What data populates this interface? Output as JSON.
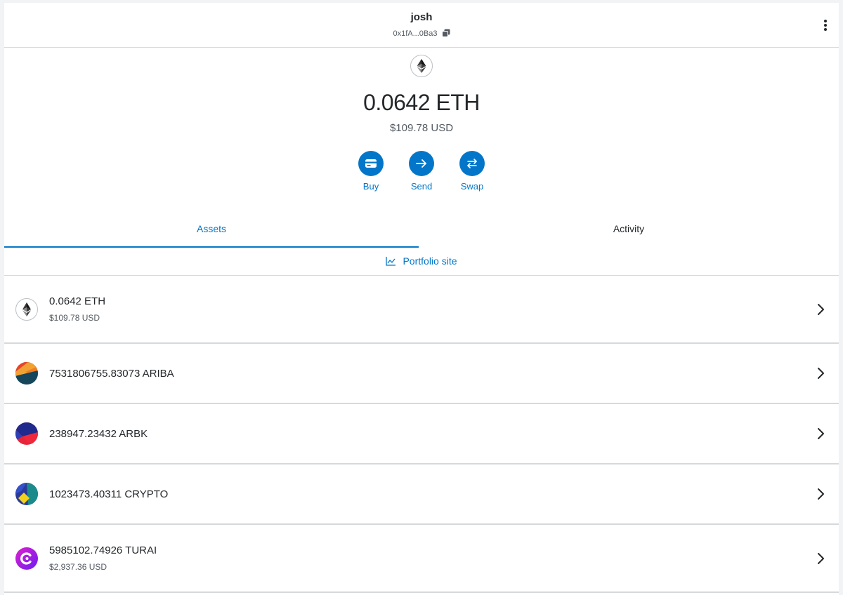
{
  "header": {
    "account_name": "josh",
    "account_address": "0x1fA...0Ba3"
  },
  "balance": {
    "primary": "0.0642 ETH",
    "secondary": "$109.78 USD"
  },
  "actions": [
    {
      "label": "Buy",
      "icon": "card-icon"
    },
    {
      "label": "Send",
      "icon": "arrow-right-icon"
    },
    {
      "label": "Swap",
      "icon": "swap-arrows-icon"
    }
  ],
  "tabs": [
    {
      "label": "Assets",
      "active": true
    },
    {
      "label": "Activity",
      "active": false
    }
  ],
  "portfolio_link": "Portfolio site",
  "assets": [
    {
      "amount": "0.0642 ETH",
      "fiat": "$109.78 USD",
      "icon": "ethereum-icon"
    },
    {
      "amount": "7531806755.83073 ARIBA",
      "fiat": "",
      "icon": "ariba-token-icon"
    },
    {
      "amount": "238947.23432 ARBK",
      "fiat": "",
      "icon": "arbk-token-icon"
    },
    {
      "amount": "1023473.40311 CRYPTO",
      "fiat": "",
      "icon": "crypto-token-icon"
    },
    {
      "amount": "5985102.74926 TURAI",
      "fiat": "$2,937.36 USD",
      "icon": "turai-token-icon"
    }
  ],
  "colors": {
    "accent": "#0376c9",
    "text": "#24272a",
    "muted": "#535a61",
    "divider": "#d6d9dc"
  }
}
